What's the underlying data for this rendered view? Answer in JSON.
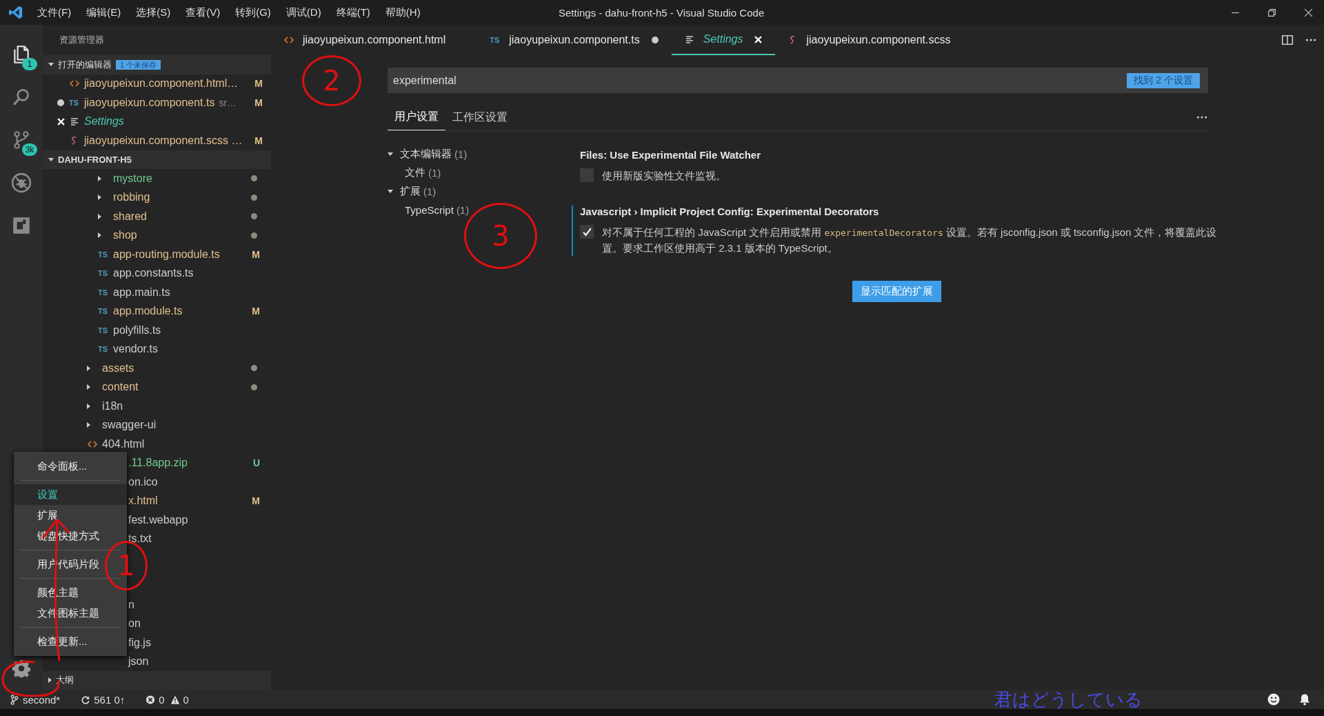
{
  "title_bar": {
    "menu": [
      "文件(F)",
      "编辑(E)",
      "选择(S)",
      "查看(V)",
      "转到(G)",
      "调试(D)",
      "终端(T)",
      "帮助(H)"
    ],
    "title": "Settings - dahu-front-h5 - Visual Studio Code"
  },
  "activity_bar": [
    {
      "kind": "files",
      "selected": true,
      "badge": "1"
    },
    {
      "kind": "search",
      "selected": false
    },
    {
      "kind": "scm",
      "selected": false,
      "badge": "3k"
    },
    {
      "kind": "debug",
      "selected": false
    },
    {
      "kind": "extensions",
      "selected": false
    }
  ],
  "sidebar": {
    "title": "资源管理器",
    "open_editors": {
      "label": "打开的编辑器",
      "badge": "1 个未保存",
      "expanded": true,
      "items": [
        {
          "kind": "html",
          "name": "jiaoyupeixun.component.html…",
          "color": "#e2c08d",
          "badge": "M",
          "dirty": false,
          "selected": false,
          "preview": false
        },
        {
          "kind": "ts",
          "icon": "TS",
          "name": "jiaoyupeixun.component.ts",
          "description": "sr…",
          "color": "#e2c08d",
          "badge": "M",
          "dirty": true,
          "selected": false,
          "preview": false
        },
        {
          "kind": "settings",
          "name": "Settings",
          "dirty": false,
          "selected": true,
          "preview": true
        },
        {
          "kind": "scss",
          "name": "jiaoyupeixun.component.scss …",
          "color": "#e2c08d",
          "badge": "M",
          "dirty": false,
          "selected": false,
          "preview": false
        }
      ]
    },
    "project": {
      "label": "DAHU-FRONT-H5",
      "expanded": true,
      "items": [
        {
          "children": [
            {
              "kind": "folder",
              "name": "mystore",
              "color": "#73c991",
              "dot": true
            },
            {
              "kind": "folder",
              "name": "robbing",
              "color": "#e2c08d",
              "dot": true
            },
            {
              "kind": "folder",
              "name": "shared",
              "color": "#e2c08d",
              "dot": true
            },
            {
              "kind": "folder",
              "name": "shop",
              "color": "#e2c08d",
              "dot": true
            },
            {
              "kind": "ts",
              "icon": "TS",
              "name": "app-routing.module.ts",
              "color": "#e2c08d",
              "badge": "M"
            },
            {
              "kind": "ts",
              "icon": "TS",
              "name": "app.constants.ts"
            },
            {
              "kind": "ts",
              "icon": "TS",
              "name": "app.main.ts"
            },
            {
              "kind": "ts",
              "icon": "TS",
              "name": "app.module.ts",
              "color": "#e2c08d",
              "badge": "M"
            },
            {
              "kind": "ts",
              "icon": "TS",
              "name": "polyfills.ts"
            },
            {
              "kind": "ts",
              "icon": "TS",
              "name": "vendor.ts"
            }
          ]
        },
        {
          "kind": "folder",
          "name": "assets",
          "color": "#e2c08d",
          "dot": true
        },
        {
          "kind": "folder",
          "name": "content",
          "color": "#e2c08d",
          "dot": true
        },
        {
          "kind": "folder",
          "name": "i18n"
        },
        {
          "kind": "folder",
          "name": "swagger-ui"
        },
        {
          "kind": "html",
          "name": "404.html"
        },
        {
          "kind": "partial",
          "name": ".11.8app.zip",
          "color": "#73c991",
          "badge": "U"
        },
        {
          "kind": "partial",
          "name": "on.ico"
        },
        {
          "kind": "partial",
          "name": "x.html",
          "color": "#e2c08d",
          "badge": "M"
        },
        {
          "kind": "partial",
          "name": "fest.webapp"
        },
        {
          "kind": "partial",
          "name": "ts.txt"
        }
      ],
      "more_items": [
        {
          "kind": "partial",
          "name": "n"
        },
        {
          "kind": "partial",
          "name": "on"
        },
        {
          "kind": "partial",
          "name": "fig.js"
        },
        {
          "kind": "partial",
          "name": "json"
        }
      ]
    },
    "outline": {
      "label": "大纲",
      "expanded": false
    }
  },
  "editor_tabs": [
    {
      "kind": "html",
      "label": "jiaoyupeixun.component.html",
      "selected": false,
      "dirty": false,
      "preview": false
    },
    {
      "kind": "ts",
      "icon": "TS",
      "label": "jiaoyupeixun.component.ts",
      "selected": false,
      "dirty": true,
      "preview": false
    },
    {
      "kind": "settings",
      "label": "Settings",
      "selected": true,
      "dirty": false,
      "preview": true
    },
    {
      "kind": "scss",
      "label": "jiaoyupeixun.component.scss",
      "selected": false,
      "dirty": false,
      "preview": false
    }
  ],
  "settings": {
    "search": {
      "value": "experimental",
      "count": "找到 2 个设置"
    },
    "tabs": [
      {
        "label": "用户设置",
        "selected": true
      },
      {
        "label": "工作区设置",
        "selected": false
      }
    ],
    "toc": [
      {
        "label": "文本编辑器",
        "count": "(1)",
        "expanded": true,
        "children": [
          {
            "label": "文件",
            "count": "(1)"
          }
        ]
      },
      {
        "label": "扩展",
        "count": "(1)",
        "expanded": true,
        "children": [
          {
            "label": "TypeScript",
            "count": "(1)"
          }
        ]
      }
    ],
    "items": [
      {
        "title": "Files: Use Experimental File Watcher",
        "checked": false,
        "focused": false,
        "description": [
          {
            "kind": "text",
            "text": "使用新版实验性文件监视。"
          }
        ]
      },
      {
        "title": "Javascript › Implicit Project Config: Experimental Decorators",
        "checked": true,
        "focused": true,
        "description": [
          {
            "kind": "text",
            "text": "对不属于任何工程的 JavaScript 文件启用或禁用 "
          },
          {
            "kind": "code",
            "text": "experimentalDecorators"
          },
          {
            "kind": "text",
            "text": " 设置。若有 jsconfig.json 或 tsconfig.json 文件，将覆盖此设置。要求工作区使用高于 2.3.1 版本的 TypeScript。"
          }
        ]
      }
    ],
    "button": "显示匹配的扩展"
  },
  "context_menu": {
    "groups": [
      [
        {
          "label": "命令面板...",
          "selected": false
        }
      ],
      [
        {
          "label": "设置",
          "selected": true
        },
        {
          "label": "扩展",
          "selected": false
        },
        {
          "label": "键盘快捷方式",
          "selected": false
        }
      ],
      [
        {
          "label": "用户代码片段",
          "selected": false
        }
      ],
      [
        {
          "label": "颜色主题",
          "selected": false
        },
        {
          "label": "文件图标主题",
          "selected": false
        }
      ],
      [
        {
          "label": "检查更新...",
          "selected": false
        }
      ]
    ]
  },
  "status_bar": {
    "branch": "second*",
    "sync": "561 0↑",
    "errors": "0",
    "warnings": "0",
    "overlay_text": "君はどうしている"
  },
  "annotations": [
    {
      "label": "2"
    },
    {
      "label": "3"
    },
    {
      "label": "1"
    }
  ]
}
